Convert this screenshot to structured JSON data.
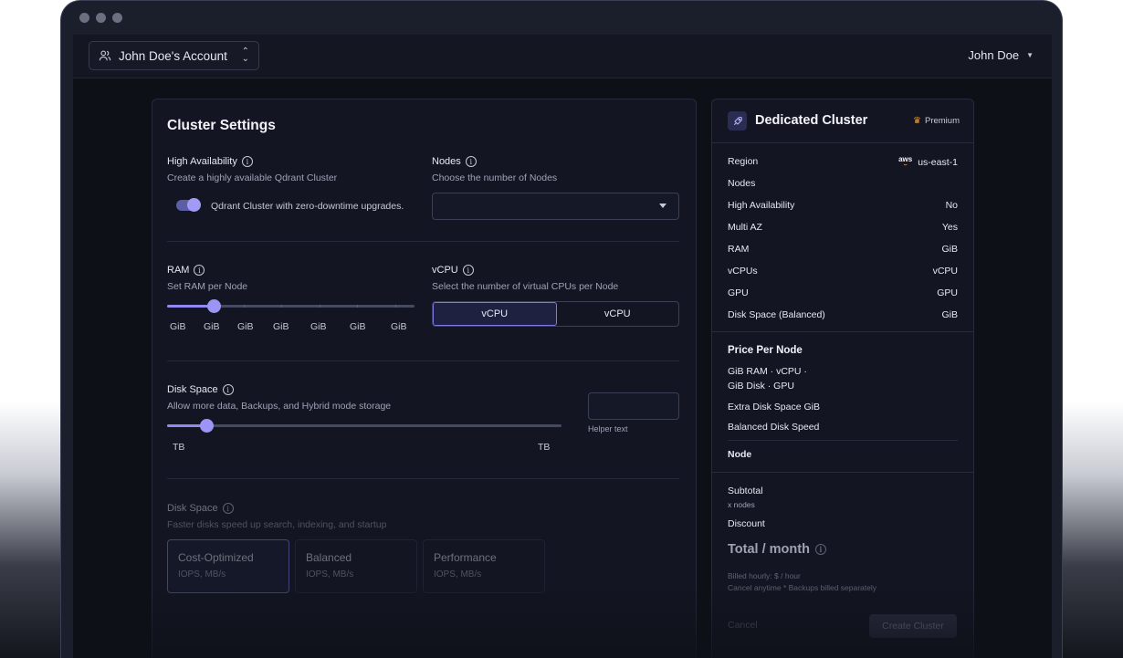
{
  "header": {
    "account_label": "John Doe's Account",
    "user_label": "John Doe"
  },
  "settings": {
    "title": "Cluster Settings",
    "high_availability": {
      "label": "High Availability",
      "description": "Create a highly available Qdrant Cluster",
      "toggle_label": "Qdrant Cluster with zero-downtime upgrades.",
      "enabled": true
    },
    "nodes": {
      "label": "Nodes",
      "description": "Choose the number of Nodes",
      "selected_value": ""
    },
    "ram": {
      "label": "RAM",
      "description": "Set RAM per Node",
      "tick_labels": [
        "GiB",
        "GiB",
        "GiB",
        "GiB",
        "GiB",
        "GiB",
        "GiB"
      ],
      "level_fraction": 0.19
    },
    "vcpu": {
      "label": "vCPU",
      "description": "Select the number of virtual CPUs per Node",
      "options": [
        "vCPU",
        "vCPU"
      ],
      "selected_index": 0
    },
    "disk_space": {
      "label": "Disk Space",
      "description": "Allow more data, Backups, and Hybrid mode storage",
      "min_label": "TB",
      "max_label": "TB",
      "input_value": "",
      "helper_text": "Helper text",
      "level_fraction": 0.1
    },
    "disk_performance": {
      "label": "Disk Space",
      "description": "Faster disks speed up search, indexing, and startup",
      "cards": [
        {
          "title": "Cost-Optimized",
          "sub": "IOPS, MB/s"
        },
        {
          "title": "Balanced",
          "sub": "IOPS, MB/s"
        },
        {
          "title": "Performance",
          "sub": "IOPS, MB/s"
        }
      ],
      "selected_index": 0
    }
  },
  "summary": {
    "title": "Dedicated Cluster",
    "badge": "Premium",
    "provider_logo": "aws",
    "rows": [
      {
        "label": "Region",
        "value": "us-east-1"
      },
      {
        "label": "Nodes",
        "value": ""
      },
      {
        "label": "High Availability",
        "value": "No"
      },
      {
        "label": "Multi AZ",
        "value": "Yes"
      },
      {
        "label": "RAM",
        "value": "GiB"
      },
      {
        "label": "vCPUs",
        "value": "vCPU"
      },
      {
        "label": "GPU",
        "value": "GPU"
      },
      {
        "label": "Disk Space (Balanced)",
        "value": "GiB"
      }
    ],
    "price_per_node": {
      "title": "Price Per Node",
      "line1": "GiB RAM · vCPU ·",
      "line2": "GiB Disk · GPU",
      "extra_disk": "Extra Disk Space GiB",
      "balanced_speed": "Balanced Disk Speed",
      "node_label": "Node"
    },
    "subtotal_label": "Subtotal",
    "nodes_multiplier": "x nodes",
    "discount_label": "Discount",
    "total_label": "Total / month",
    "billed_hourly": "Billed hourly: $ / hour",
    "cancel_note": "Cancel anytime * Backups billed separately",
    "cancel_button": "Cancel",
    "create_button": "Create Cluster"
  }
}
